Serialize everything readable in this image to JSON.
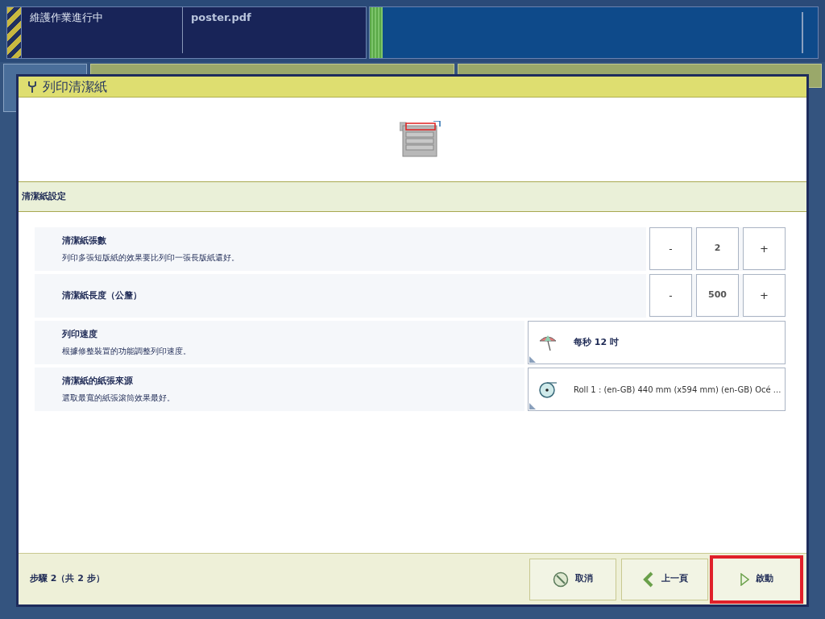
{
  "status_bar": {
    "status": "維護作業進行中",
    "job": "poster.pdf"
  },
  "dialog": {
    "title": "列印清潔紙",
    "section": "清潔紙設定",
    "settings": [
      {
        "kind": "stepper",
        "label": "清潔紙張數",
        "description": "列印多張短版紙的效果要比列印一張長版紙還好。",
        "decrement": "-",
        "value": "2",
        "increment": "+"
      },
      {
        "kind": "stepper",
        "label": "清潔紙長度（公釐）",
        "decrement": "-",
        "value": "500",
        "increment": "+"
      },
      {
        "kind": "selector",
        "label": "列印速度",
        "description": "根據修整裝置的功能調整列印速度。",
        "value": "每秒 12 吋"
      },
      {
        "kind": "selector",
        "label": "清潔紙的紙張來源",
        "description": "選取最寬的紙張滾筒效果最好。",
        "value": "Roll 1 : (en-GB) 440 mm (x594 mm) (en-GB) Océ ..."
      }
    ],
    "step": "步驟 2（共 2 步）",
    "buttons": [
      {
        "label": "取消",
        "highlighted": false
      },
      {
        "label": "上一頁",
        "highlighted": false
      },
      {
        "label": "啟動",
        "highlighted": true
      }
    ]
  }
}
